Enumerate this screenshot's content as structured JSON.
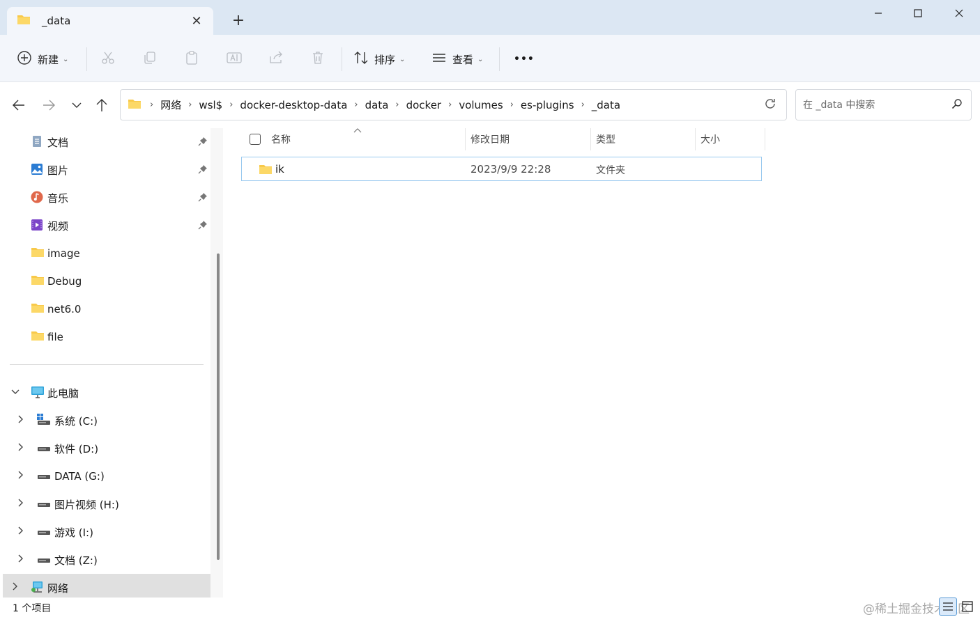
{
  "window": {
    "tab_title": "_data",
    "new_tab_symbol": "+"
  },
  "toolbar": {
    "new_label": "新建",
    "sort_label": "排序",
    "view_label": "查看",
    "more_label": "•••"
  },
  "address": {
    "segments": [
      "网络",
      "wsl$",
      "docker-desktop-data",
      "data",
      "docker",
      "volumes",
      "es-plugins",
      "_data"
    ]
  },
  "search": {
    "placeholder": "在 _data 中搜索"
  },
  "sidebar": {
    "quick_access": [
      {
        "label": "文档",
        "icon": "documents-icon",
        "pinned": true
      },
      {
        "label": "图片",
        "icon": "pictures-icon",
        "pinned": true
      },
      {
        "label": "音乐",
        "icon": "music-icon",
        "pinned": true
      },
      {
        "label": "视频",
        "icon": "videos-icon",
        "pinned": true
      },
      {
        "label": "image",
        "icon": "folder-icon",
        "pinned": false
      },
      {
        "label": "Debug",
        "icon": "folder-icon",
        "pinned": false
      },
      {
        "label": "net6.0",
        "icon": "folder-icon",
        "pinned": false
      },
      {
        "label": "file",
        "icon": "folder-icon",
        "pinned": false
      }
    ],
    "this_pc": "此电脑",
    "drives": [
      {
        "label": "系统 (C:)",
        "icon": "windows-drive-icon"
      },
      {
        "label": "软件 (D:)",
        "icon": "drive-icon"
      },
      {
        "label": "DATA (G:)",
        "icon": "drive-icon"
      },
      {
        "label": "图片视频 (H:)",
        "icon": "drive-icon"
      },
      {
        "label": "游戏 (I:)",
        "icon": "drive-icon"
      },
      {
        "label": "文档 (Z:)",
        "icon": "drive-icon"
      }
    ],
    "network": "网络"
  },
  "file_list": {
    "columns": {
      "name": "名称",
      "modified": "修改日期",
      "type": "类型",
      "size": "大小"
    },
    "rows": [
      {
        "name": "ik",
        "modified": "2023/9/9 22:28",
        "type": "文件夹",
        "size": ""
      }
    ]
  },
  "status": {
    "item_count": "1 个项目",
    "watermark": "@稀土掘金技术社区"
  },
  "colors": {
    "accent": "#0067c0",
    "folder": "#f8c94a",
    "selection_border": "#99c9ef",
    "titlebar": "#dce7f3"
  }
}
